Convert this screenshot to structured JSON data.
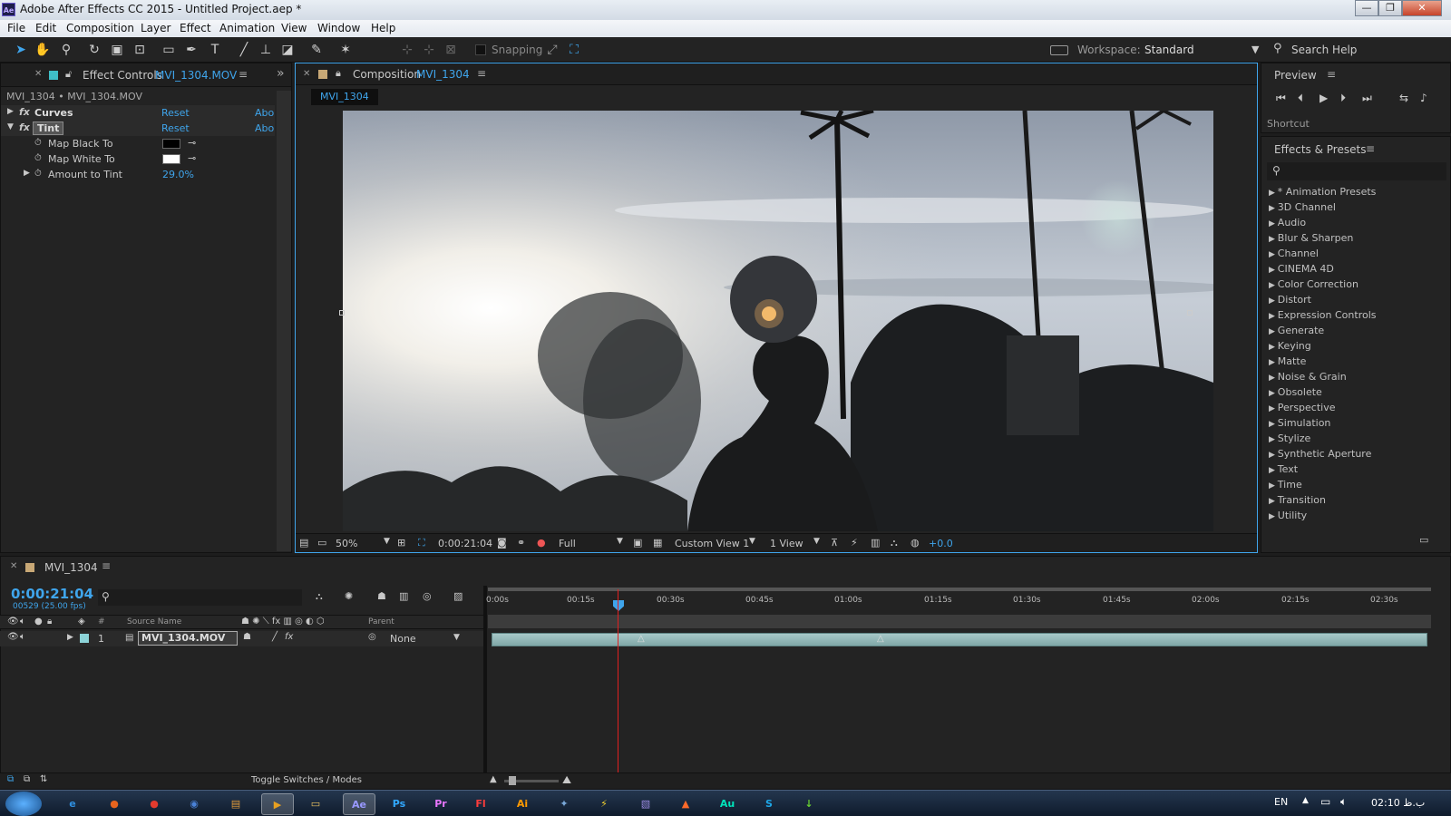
{
  "window": {
    "title": "Adobe After Effects CC 2015 - Untitled Project.aep *",
    "app_icon": "Ae"
  },
  "menu": [
    "File",
    "Edit",
    "Composition",
    "Layer",
    "Effect",
    "Animation",
    "View",
    "Window",
    "Help"
  ],
  "toolbar": {
    "snapping": "Snapping",
    "workspace_label": "Workspace:",
    "workspace_value": "Standard",
    "search_help": "Search Help"
  },
  "effect_controls": {
    "tab_label": "Effect Controls",
    "tab_target": "MVI_1304.MOV",
    "breadcrumb": "MVI_1304 • MVI_1304.MOV",
    "effects": [
      {
        "name": "Curves",
        "reset": "Reset",
        "about": "Abo"
      },
      {
        "name": "Tint",
        "reset": "Reset",
        "about": "Abo"
      }
    ],
    "params": [
      {
        "name": "Map Black To",
        "swatch": "#000000"
      },
      {
        "name": "Map White To",
        "swatch": "#ffffff"
      },
      {
        "name": "Amount to Tint",
        "value": "29.0%"
      }
    ]
  },
  "composition": {
    "tab_label": "Composition",
    "tab_target": "MVI_1304",
    "subtab": "MVI_1304",
    "zoom": "50%",
    "timecode": "0:00:21:04",
    "resolution": "Full",
    "view": "Custom View 1",
    "views": "1 View",
    "exposure": "+0.0"
  },
  "preview": {
    "title": "Preview",
    "shortcut": "Shortcut"
  },
  "effects_presets": {
    "title": "Effects & Presets",
    "items": [
      "* Animation Presets",
      "3D Channel",
      "Audio",
      "Blur & Sharpen",
      "Channel",
      "CINEMA 4D",
      "Color Correction",
      "Distort",
      "Expression Controls",
      "Generate",
      "Keying",
      "Matte",
      "Noise & Grain",
      "Obsolete",
      "Perspective",
      "Simulation",
      "Stylize",
      "Synthetic Aperture",
      "Text",
      "Time",
      "Transition",
      "Utility"
    ]
  },
  "timeline": {
    "tab_label": "MVI_1304",
    "timecode": "0:00:21:04",
    "frames": "00529 (25.00 fps)",
    "columns": {
      "num": "#",
      "source": "Source Name",
      "parent": "Parent"
    },
    "layer": {
      "index": "1",
      "name": "MVI_1304.MOV",
      "parent": "None"
    },
    "ruler": [
      "0:00s",
      "00:15s",
      "00:30s",
      "00:45s",
      "01:00s",
      "01:15s",
      "01:30s",
      "01:45s",
      "02:00s",
      "02:15s",
      "02:30s"
    ],
    "toggle_label": "Toggle Switches / Modes"
  },
  "taskbar": {
    "apps": [
      {
        "label": "e",
        "color": "#2f8fe0"
      },
      {
        "label": "●",
        "color": "#e8641e"
      },
      {
        "label": "●",
        "color": "#e33b2e"
      },
      {
        "label": "◉",
        "color": "#4a82d8"
      },
      {
        "label": "▤",
        "color": "#e09a3a"
      },
      {
        "label": "▶",
        "color": "#e8a020"
      },
      {
        "label": "▭",
        "color": "#e8c060"
      },
      {
        "label": "Ae",
        "color": "#9999ff"
      },
      {
        "label": "Ps",
        "color": "#31a8ff"
      },
      {
        "label": "Pr",
        "color": "#ea77ff"
      },
      {
        "label": "Fl",
        "color": "#ff3c3c"
      },
      {
        "label": "Ai",
        "color": "#ff9a00"
      },
      {
        "label": "✦",
        "color": "#7aa8d8"
      },
      {
        "label": "⚡",
        "color": "#f2d030"
      },
      {
        "label": "▧",
        "color": "#9a8ae0"
      },
      {
        "label": "▲",
        "color": "#ff6a2a"
      },
      {
        "label": "Au",
        "color": "#00e4bb"
      },
      {
        "label": "S",
        "color": "#1ea7e8"
      },
      {
        "label": "↓",
        "color": "#66cc33"
      }
    ],
    "lang": "EN",
    "clock": "02:10 ب.ظ"
  }
}
